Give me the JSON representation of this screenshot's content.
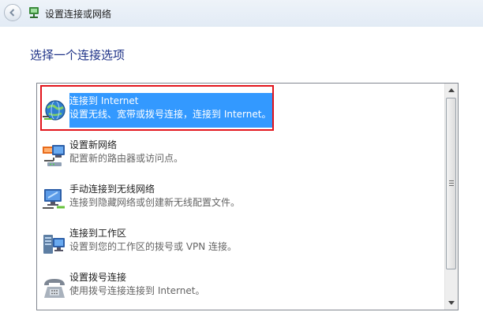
{
  "window": {
    "title": "设置连接或网络"
  },
  "main": {
    "heading": "选择一个连接选项"
  },
  "options": [
    {
      "title": "连接到 Internet",
      "description": "设置无线、宽带或拨号连接，连接到 Internet。",
      "icon": "globe-network-icon",
      "selected": true
    },
    {
      "title": "设置新网络",
      "description": "配置新的路由器或访问点。",
      "icon": "router-network-icon",
      "selected": false
    },
    {
      "title": "手动连接到无线网络",
      "description": "连接到隐藏网络或创建新无线配置文件。",
      "icon": "wireless-monitor-icon",
      "selected": false
    },
    {
      "title": "连接到工作区",
      "description": "设置到您的工作区的拨号或 VPN 连接。",
      "icon": "workplace-server-icon",
      "selected": false
    },
    {
      "title": "设置拨号连接",
      "description": "使用拨号连接连接到 Internet。",
      "icon": "telephone-icon",
      "selected": false
    }
  ],
  "colors": {
    "selection": "#3399ff",
    "highlight_outline": "#e2141b",
    "heading": "#1e3287"
  }
}
